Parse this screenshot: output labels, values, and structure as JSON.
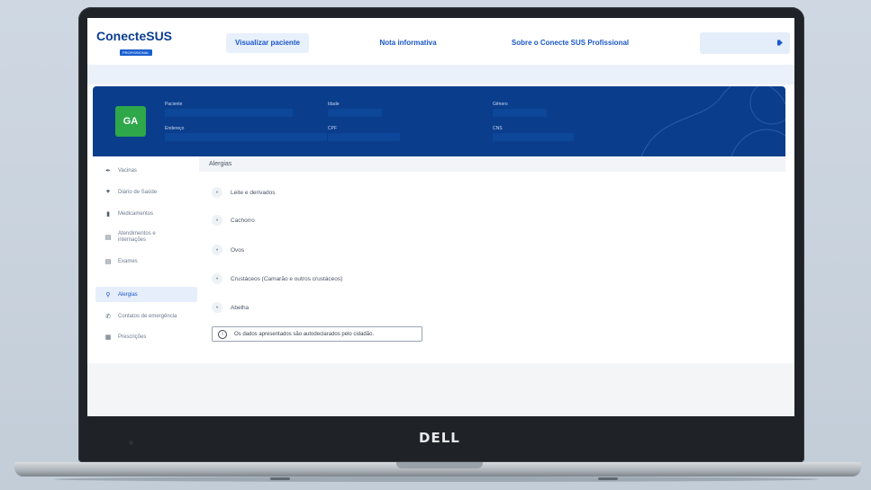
{
  "brand": {
    "logo_main": "ConecteSUS",
    "logo_sub": "PROFISSIONAL",
    "device_logo": "DELL"
  },
  "nav": {
    "visualizar": "Visualizar paciente",
    "nota": "Nota informativa",
    "sobre": "Sobre o Conecte SUS Profissional",
    "logout_icon": "logout-icon"
  },
  "patient": {
    "initials": "GA",
    "labels": {
      "paciente": "Paciente",
      "idade": "Idade",
      "genero": "Gênero",
      "endereco": "Endereço",
      "cpf": "CPF",
      "cns": "CNS"
    }
  },
  "sidebar": {
    "items": [
      {
        "label": "Vacinas",
        "icon": "syringe-icon"
      },
      {
        "label": "Diário de Saúde",
        "icon": "heart-icon"
      },
      {
        "label": "Medicamentos",
        "icon": "pill-bottle-icon"
      },
      {
        "label": "Atendimentos e internações",
        "icon": "hospital-icon"
      },
      {
        "label": "Exames",
        "icon": "lab-icon"
      },
      {
        "label": "Alergias",
        "icon": "search-icon"
      },
      {
        "label": "Contatos de emergência",
        "icon": "phone-icon"
      },
      {
        "label": "Prescrições",
        "icon": "clipboard-icon"
      }
    ],
    "active_index": 5
  },
  "content": {
    "title": "Alergias",
    "allergies": [
      {
        "label": "Leite e derivados"
      },
      {
        "label": "Cachorro"
      },
      {
        "label": "Ovos"
      },
      {
        "label": "Crustáceos (Camarão e outros crustáceos)"
      },
      {
        "label": "Abelha"
      }
    ],
    "notice": "Os dados apresentados são autodeclarados pelo cidadão.",
    "notice_icon": "info-icon"
  },
  "colors": {
    "brand_blue": "#0a3e8c",
    "accent_blue": "#1a56c9",
    "avatar_green": "#2ea84a"
  }
}
